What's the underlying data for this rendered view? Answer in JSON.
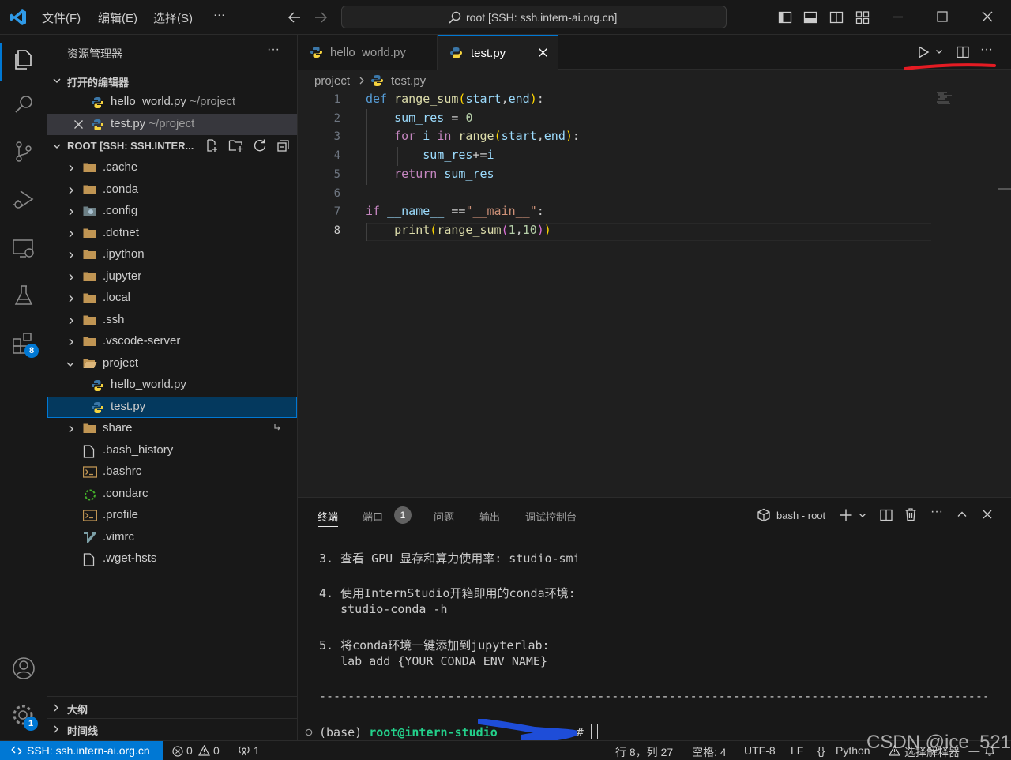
{
  "titlebar": {
    "menus": [
      "文件(F)",
      "编辑(E)",
      "选择(S)",
      "···"
    ],
    "command_center": "root [SSH: ssh.intern-ai.org.cn]"
  },
  "activitybar": {
    "extensions_badge": "8",
    "settings_badge": "1"
  },
  "sidebar": {
    "title": "资源管理器",
    "open_editors_label": "打开的编辑器",
    "open_editors": [
      {
        "name": "hello_world.py",
        "path": "~/project"
      },
      {
        "name": "test.py",
        "path": "~/project"
      }
    ],
    "root_label": "ROOT [SSH: SSH.INTER...",
    "tree": [
      ".cache",
      ".conda",
      ".config",
      ".dotnet",
      ".ipython",
      ".jupyter",
      ".local",
      ".ssh",
      ".vscode-server",
      "project",
      "hello_world.py",
      "test.py",
      "share",
      ".bash_history",
      ".bashrc",
      ".condarc",
      ".profile",
      ".vimrc",
      ".wget-hsts"
    ],
    "outline_label": "大纲",
    "timeline_label": "时间线"
  },
  "editor": {
    "tabs": [
      "hello_world.py",
      "test.py"
    ],
    "breadcrumb": [
      "project",
      "test.py"
    ],
    "line_numbers": [
      "1",
      "2",
      "3",
      "4",
      "5",
      "6",
      "7",
      "8"
    ]
  },
  "panel": {
    "tabs": [
      "终端",
      "端口",
      "问题",
      "输出",
      "调试控制台"
    ],
    "ports_badge": "1",
    "terminal_name": "bash - root",
    "lines": [
      "3. 查看 GPU 显存和算力使用率: studio-smi",
      "4. 使用InternStudio开箱即用的conda环境:",
      "   studio-conda -h",
      "5. 将conda环境一键添加到jupyterlab:",
      "   lab add {YOUR_CONDA_ENV_NAME}",
      "------------------------------------------------------------------------------------------------------"
    ],
    "prompt_base": "(base)",
    "prompt_user": "root@intern-studio",
    "prompt_end": "#"
  },
  "statusbar": {
    "remote": "SSH: ssh.intern-ai.org.cn",
    "errors": "0",
    "warnings": "0",
    "ports": "1",
    "position": "行 8，列 27",
    "spaces": "空格: 4",
    "encoding": "UTF-8",
    "eol": "LF",
    "language": "Python",
    "interpreter": "选择解释器",
    "watermark": "CSDN @ice_521"
  },
  "colors": {
    "accent": "#0078d4",
    "annotation_red": "#e51b23",
    "redaction_blue": "#1e4dd8"
  }
}
